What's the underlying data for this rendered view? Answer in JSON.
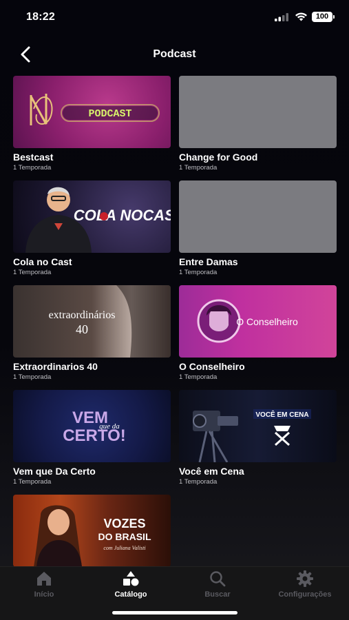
{
  "status": {
    "time": "18:22",
    "battery": "100"
  },
  "header": {
    "title": "Podcast"
  },
  "items": [
    {
      "title": "Bestcast",
      "subtitle": "1 Temporada",
      "art_text": "PODCAST"
    },
    {
      "title": "Change for Good",
      "subtitle": "1 Temporada"
    },
    {
      "title": "Cola no Cast",
      "subtitle": "1 Temporada",
      "art_text": "COLA NOCAST"
    },
    {
      "title": "Entre Damas",
      "subtitle": "1 Temporada"
    },
    {
      "title": "Extraordinarios 40",
      "subtitle": "1 Temporada",
      "art_text": "extraordinários",
      "art_num": "40"
    },
    {
      "title": "O Conselheiro",
      "subtitle": "1 Temporada",
      "art_text": "O Conselheiro"
    },
    {
      "title": "Vem que Da Certo",
      "subtitle": "1 Temporada",
      "art_line1": "VEM",
      "art_line2": "que da",
      "art_line3": "CERTO!"
    },
    {
      "title": "Você em Cena",
      "subtitle": "1 Temporada",
      "art_text": "VOCÊ EM CENA"
    },
    {
      "title": "Vozes do Brasil",
      "art_line1": "VOZES",
      "art_line2": "DO BRASIL",
      "art_line3": "com Juliana Valisti"
    }
  ],
  "tabs": [
    {
      "label": "Início",
      "icon": "home-icon",
      "active": false
    },
    {
      "label": "Catálogo",
      "icon": "shapes-icon",
      "active": true
    },
    {
      "label": "Buscar",
      "icon": "search-icon",
      "active": false
    },
    {
      "label": "Configurações",
      "icon": "gear-icon",
      "active": false
    }
  ],
  "colors": {
    "background": "#05050c",
    "placeholder": "#7b7b80",
    "tab_inactive": "#5a5a60",
    "tab_active": "#ffffff"
  }
}
